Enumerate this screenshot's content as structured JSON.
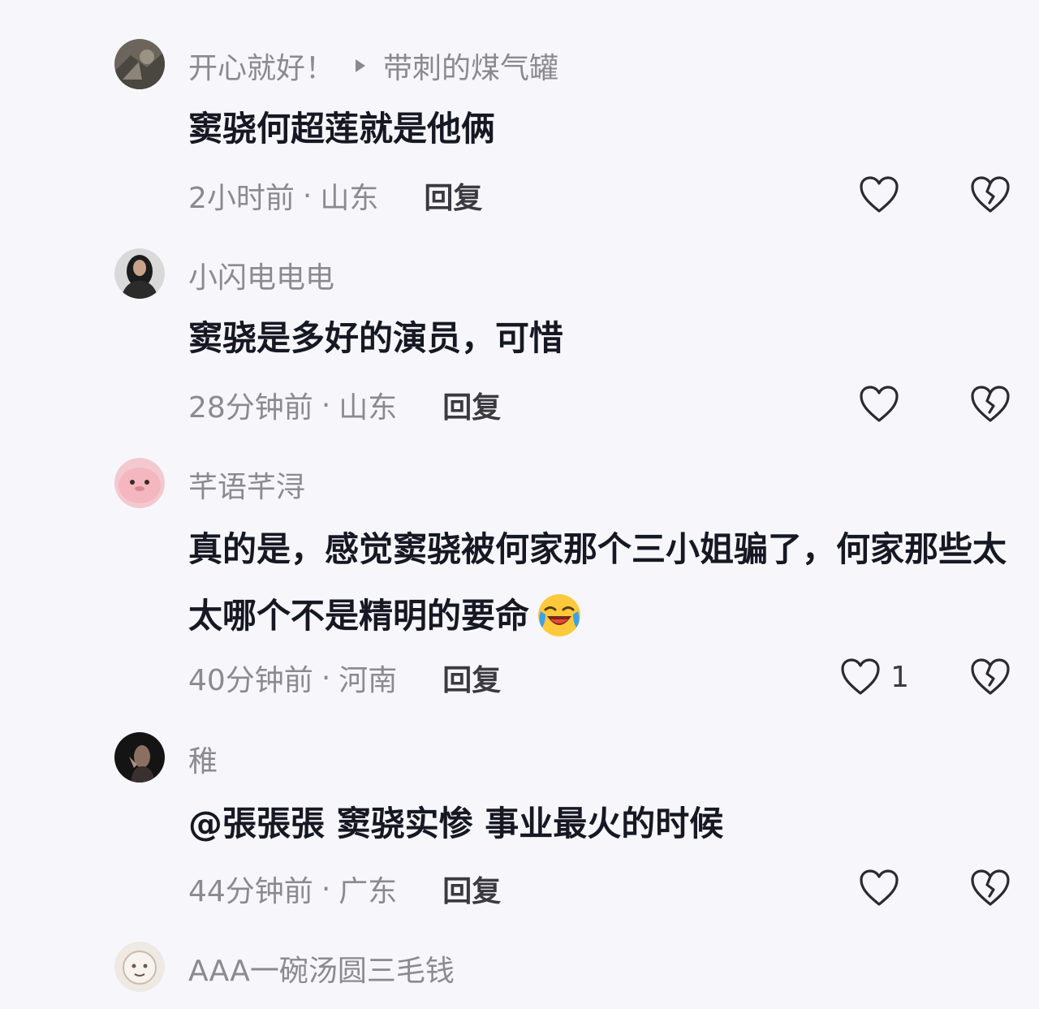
{
  "comments": [
    {
      "username": "开心就好！",
      "reply_to": "带刺的煤气罐",
      "text": "窦骁何超莲就是他俩",
      "time": "2小时前",
      "location": "山东",
      "reply_label": "回复",
      "likes": ""
    },
    {
      "username": "小闪电电电",
      "text": "窦骁是多好的演员，可惜",
      "time": "28分钟前",
      "location": "山东",
      "reply_label": "回复",
      "likes": ""
    },
    {
      "username": "芊语芊浔",
      "text": "真的是，感觉窦骁被何家那个三小姐骗了，何家那些太太哪个不是精明的要命",
      "time": "40分钟前",
      "location": "河南",
      "reply_label": "回复",
      "likes": "1",
      "emoji": "laughing-crying-emoji"
    },
    {
      "username": "稚",
      "text": "@張張張 窦骁实惨 事业最火的时候",
      "time": "44分钟前",
      "location": "广东",
      "reply_label": "回复",
      "likes": ""
    },
    {
      "username": "AAA一碗汤圆三毛钱"
    }
  ],
  "meta_separator": "·",
  "icons": {
    "like": "heart-outline-icon",
    "dislike": "broken-heart-icon",
    "reply_indicator": "triangle-right-icon"
  },
  "colors": {
    "background": "#f7f7fb",
    "text_primary": "#161823",
    "text_secondary": "#8a8a8f"
  }
}
